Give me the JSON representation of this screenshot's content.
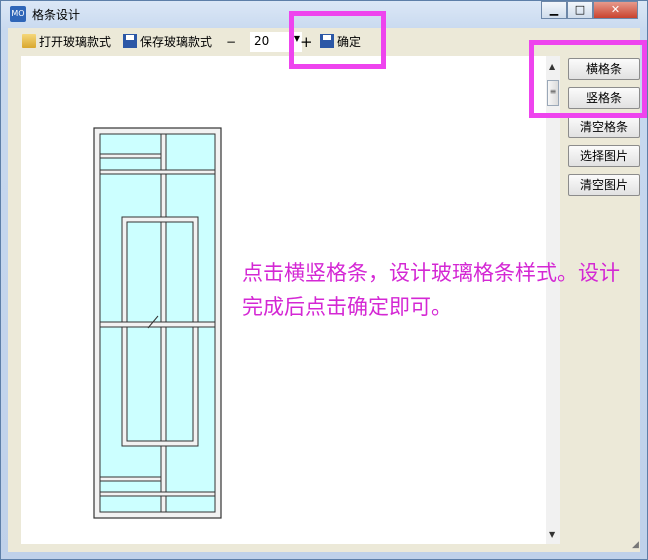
{
  "window": {
    "title": "格条设计",
    "app_icon_text": "MO",
    "minimize_glyph": "▁",
    "maximize_glyph": "□",
    "close_glyph": "✕"
  },
  "toolbar": {
    "open_label": "打开玻璃款式",
    "save_label": "保存玻璃款式",
    "zoom_out_label": "−",
    "zoom_value": "20",
    "zoom_in_label": "+",
    "confirm_label": "确定"
  },
  "side_buttons": {
    "horizontal_bar": "横格条",
    "vertical_bar": "竖格条",
    "clear_bars": "清空格条",
    "select_image": "选择图片",
    "clear_image": "清空图片"
  },
  "annotation": {
    "text": "点击横竖格条，设计玻璃格条样式。设计完成后点击确定即可。"
  },
  "colors": {
    "highlight": "#ee44ee",
    "annotation": "#d428d4",
    "glass": "#ccffff",
    "bar_fill": "#f2f2f2",
    "frame_stroke": "#333333"
  },
  "icons": {
    "open": "folder-open-icon",
    "save": "floppy-disk-icon",
    "confirm": "floppy-disk-icon",
    "dropdown": "chevron-down-icon",
    "scroll_up": "arrow-up-icon",
    "scroll_down": "arrow-down-icon"
  }
}
